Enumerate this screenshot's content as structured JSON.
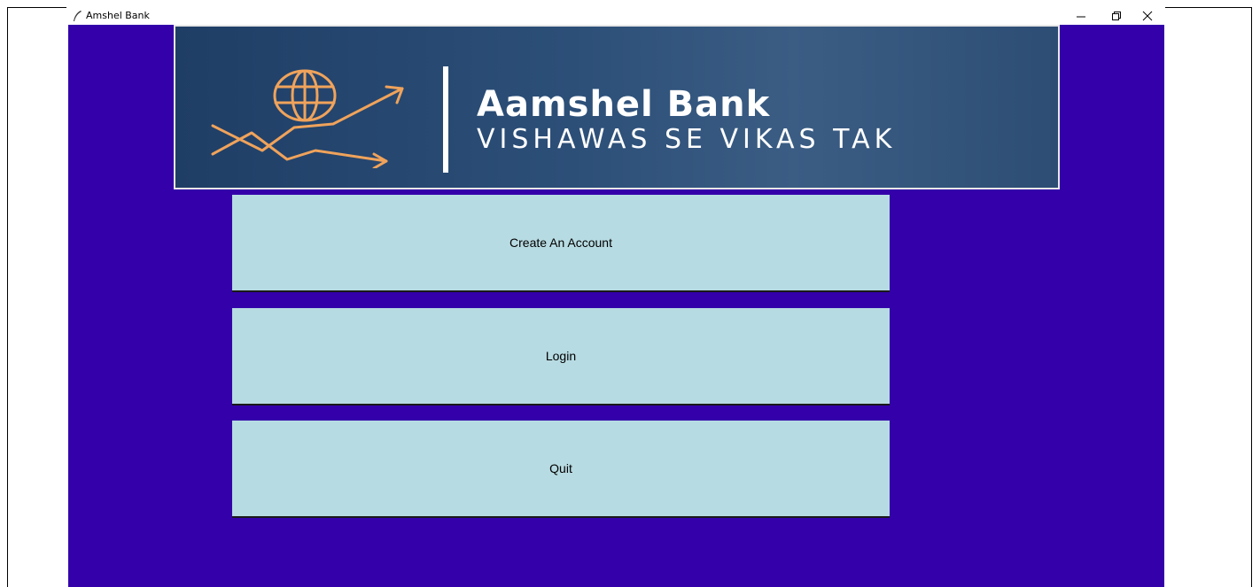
{
  "window": {
    "title": "Amshel Bank"
  },
  "banner": {
    "bank_name": "Aamshel Bank",
    "tagline": "VISHAWAS SE VIKAS TAK",
    "logo_icon": "globe-growth-arrow-icon",
    "logo_color": "#f0a35b"
  },
  "menu": {
    "create_account_label": "Create An Account",
    "login_label": "Login",
    "quit_label": "Quit"
  },
  "colors": {
    "background": "#3300aa",
    "button": "#b7dbe2",
    "banner": "#2c4f78"
  }
}
